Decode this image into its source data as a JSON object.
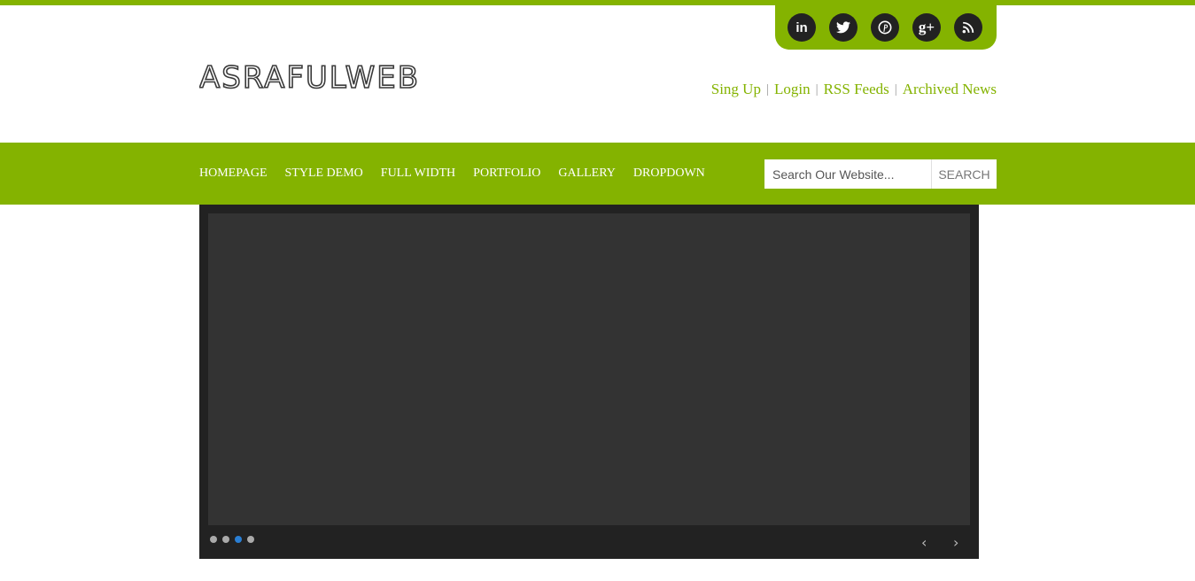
{
  "header": {
    "logo_text": "ASRAFULWEB",
    "links": [
      {
        "label": "Sing Up"
      },
      {
        "label": "Login"
      },
      {
        "label": "RSS Feeds"
      },
      {
        "label": "Archived News"
      }
    ],
    "separator": "|"
  },
  "social": [
    {
      "icon": "linkedin-icon",
      "glyph": "in"
    },
    {
      "icon": "twitter-icon",
      "glyph": ""
    },
    {
      "icon": "pinterest-icon",
      "glyph": ""
    },
    {
      "icon": "google-plus-icon",
      "glyph": "g+"
    },
    {
      "icon": "rss-icon",
      "glyph": ""
    }
  ],
  "nav": {
    "items": [
      "HOMEPAGE",
      "STYLE DEMO",
      "FULL WIDTH",
      "PORTFOLIO",
      "GALLERY",
      "DROPDOWN"
    ]
  },
  "search": {
    "placeholder": "Search Our Website...",
    "button_label": "SEARCH"
  },
  "slider": {
    "dot_count": 4,
    "active_dot": 3,
    "prev_glyph": "‹",
    "next_glyph": "›"
  },
  "colors": {
    "accent": "#84b300",
    "slider_bg": "#222222",
    "slide_bg": "#333333",
    "active_dot": "#2a7fd4"
  }
}
